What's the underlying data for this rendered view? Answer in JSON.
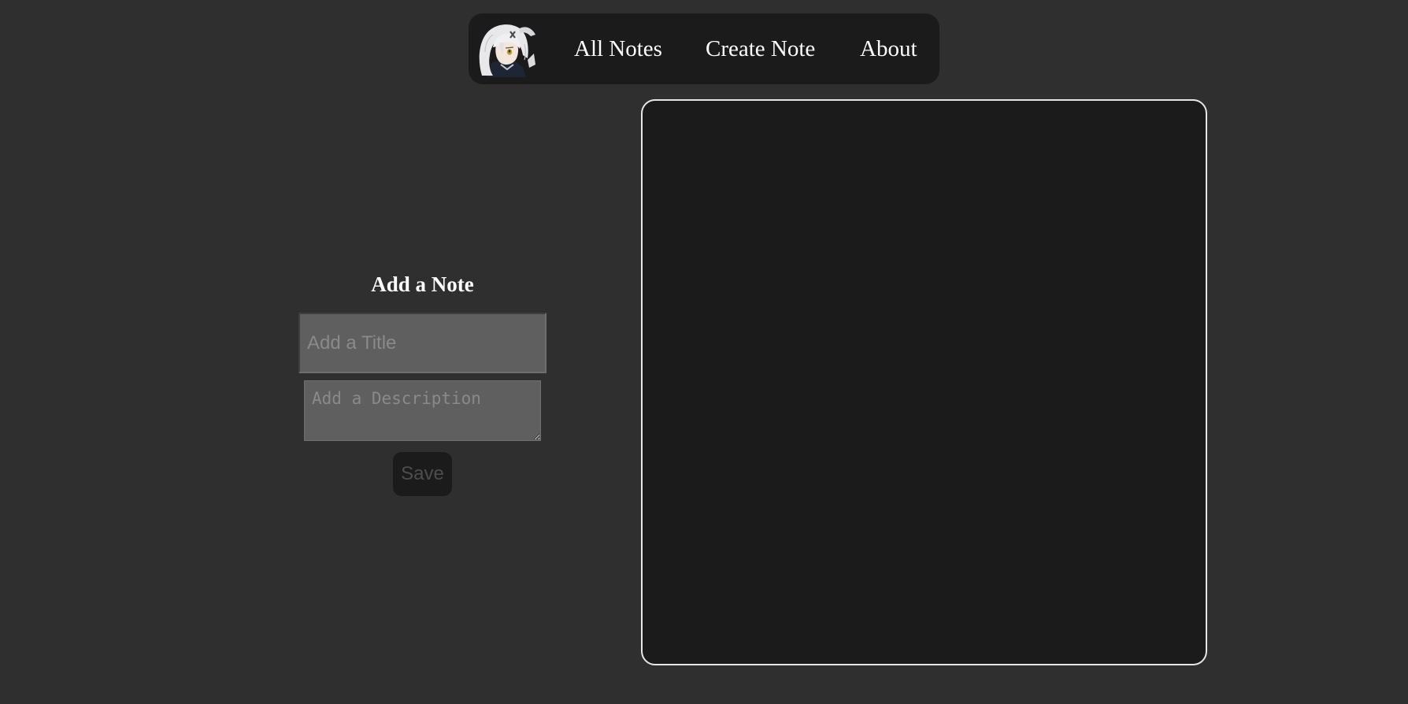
{
  "nav": {
    "avatar_icon": "anime-girl-avatar-icon",
    "links": [
      {
        "label": "All Notes"
      },
      {
        "label": "Create Note"
      },
      {
        "label": "About"
      }
    ]
  },
  "form": {
    "heading": "Add a Note",
    "title_placeholder": "Add a Title",
    "title_value": "",
    "description_placeholder": "Add a Description",
    "description_value": "",
    "save_label": "Save"
  },
  "notes": {
    "items": []
  },
  "colors": {
    "background": "#2f2f2f",
    "panel": "#1b1b1b",
    "input": "#5f5f5f",
    "text": "#ffffff",
    "panel_border": "#e6e6e6"
  }
}
